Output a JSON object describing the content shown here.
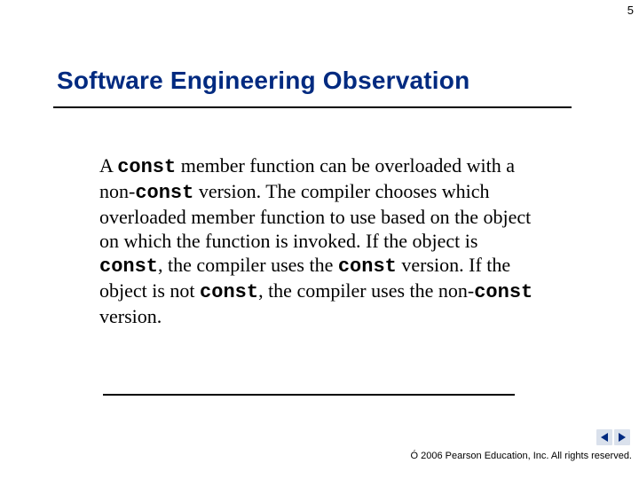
{
  "page_number": "5",
  "title": "Software Engineering Observation",
  "body": {
    "t1": "A ",
    "kw1": "const",
    "t2": " member function can be overloaded with a non-",
    "kw2": "const",
    "t3": " version. The compiler chooses which overloaded member function to use based on the object on which the function is invoked. If the object is ",
    "kw3": "const",
    "t4": ", the compiler uses the ",
    "kw4": "const",
    "t5": " version. If the object is not ",
    "kw5": "const",
    "t6": ", the compiler uses the non-",
    "kw6": "const",
    "t7": " version."
  },
  "footer": {
    "copyright_symbol": "Ó",
    "text": " 2006 Pearson Education, Inc.  All rights reserved."
  },
  "nav": {
    "prev": "previous slide",
    "next": "next slide"
  }
}
